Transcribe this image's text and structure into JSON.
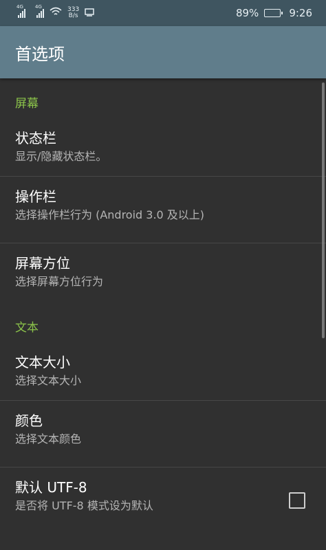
{
  "status_bar": {
    "network1": "4G",
    "network2": "4G",
    "speed_value": "333",
    "speed_unit": "B/s",
    "battery": "89%",
    "time": "9:26"
  },
  "app_bar": {
    "title": "首选项"
  },
  "sections": {
    "screen": {
      "header": "屏幕",
      "items": [
        {
          "title": "状态栏",
          "summary": "显示/隐藏状态栏。"
        },
        {
          "title": "操作栏",
          "summary": "选择操作栏行为 (Android 3.0 及以上)"
        },
        {
          "title": "屏幕方位",
          "summary": "选择屏幕方位行为"
        }
      ]
    },
    "text": {
      "header": "文本",
      "items": [
        {
          "title": "文本大小",
          "summary": "选择文本大小"
        },
        {
          "title": "颜色",
          "summary": "选择文本颜色"
        },
        {
          "title": "默认 UTF-8",
          "summary": "是否将 UTF-8 模式设为默认",
          "checked": false
        }
      ]
    }
  },
  "colors": {
    "status_bar": "#3f5560",
    "app_bar": "#607d8b",
    "background": "#303030",
    "category": "#8bc34a"
  }
}
